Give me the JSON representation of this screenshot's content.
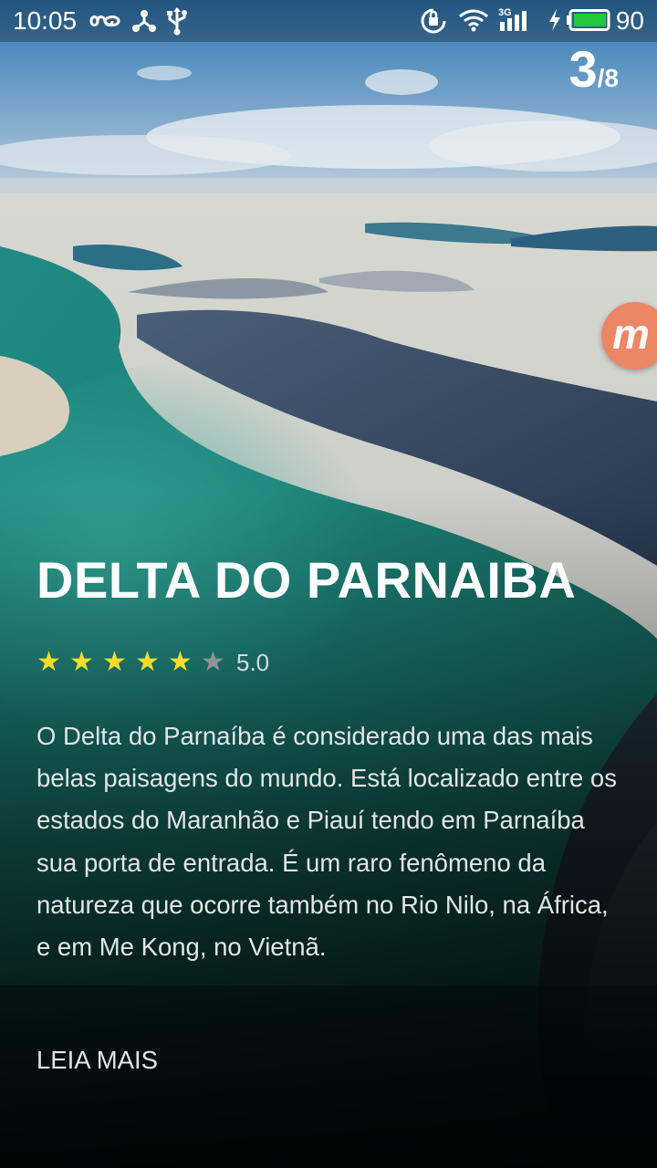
{
  "status_bar": {
    "time": "10:05",
    "network_label": "3G",
    "battery_level": "90",
    "icons": [
      "infinity-icon",
      "share-nodes-icon",
      "usb-icon",
      "rotation-lock-icon",
      "wifi-icon",
      "signal-icon",
      "charging-icon",
      "battery-icon"
    ]
  },
  "pager": {
    "current": "3",
    "total": "/8"
  },
  "floating_button": {
    "letter": "m",
    "color": "#f0805b"
  },
  "place": {
    "title": "DELTA DO PARNAIBA",
    "rating": {
      "stars_filled": 5,
      "stars_total": 6,
      "value": "5.0"
    },
    "description": "O Delta do Parnaíba é considerado uma das mais belas paisagens do mundo. Está localizado entre os estados do Maranhão e Piauí tendo em Parnaíba sua porta de entrada. É um raro fenômeno da natureza que ocorre também no Rio Nilo, na África, e em Me Kong, no Vietnã.",
    "read_more_label": "LEIA MAIS"
  },
  "colors": {
    "star_on": "#f5dc2a",
    "star_off": "#8f9496",
    "text": "#e2e6e6"
  }
}
